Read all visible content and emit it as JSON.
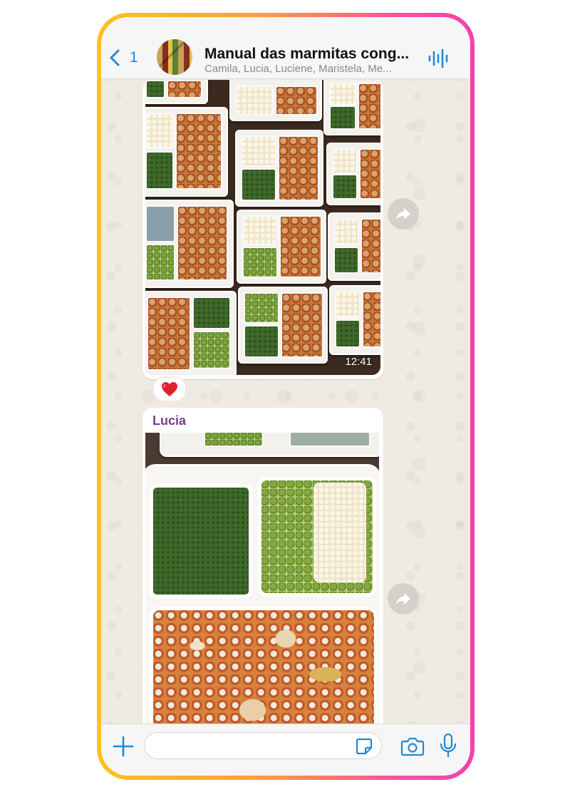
{
  "header": {
    "back_count": "1",
    "title": "Manual das marmitas cong...",
    "subtitle": "Camila, Lucia, Luciene, Maristela, Me..."
  },
  "messages": [
    {
      "type": "image",
      "time": "12:41",
      "reaction": "❤️"
    },
    {
      "type": "image",
      "sender": "Lucia"
    }
  ],
  "input": {
    "placeholder": "",
    "value": ""
  },
  "colors": {
    "accent": "#1f8ad6",
    "sender_name": "#7a3f8f",
    "chat_background": "#efeae2",
    "frame_gradient_start": "#ffc21e",
    "frame_gradient_end": "#f43fb0"
  },
  "icons": [
    "chevron-left-icon",
    "group-avatar",
    "audio-wave-icon",
    "forward-icon",
    "plus-icon",
    "sticker-icon",
    "camera-icon",
    "microphone-icon"
  ]
}
